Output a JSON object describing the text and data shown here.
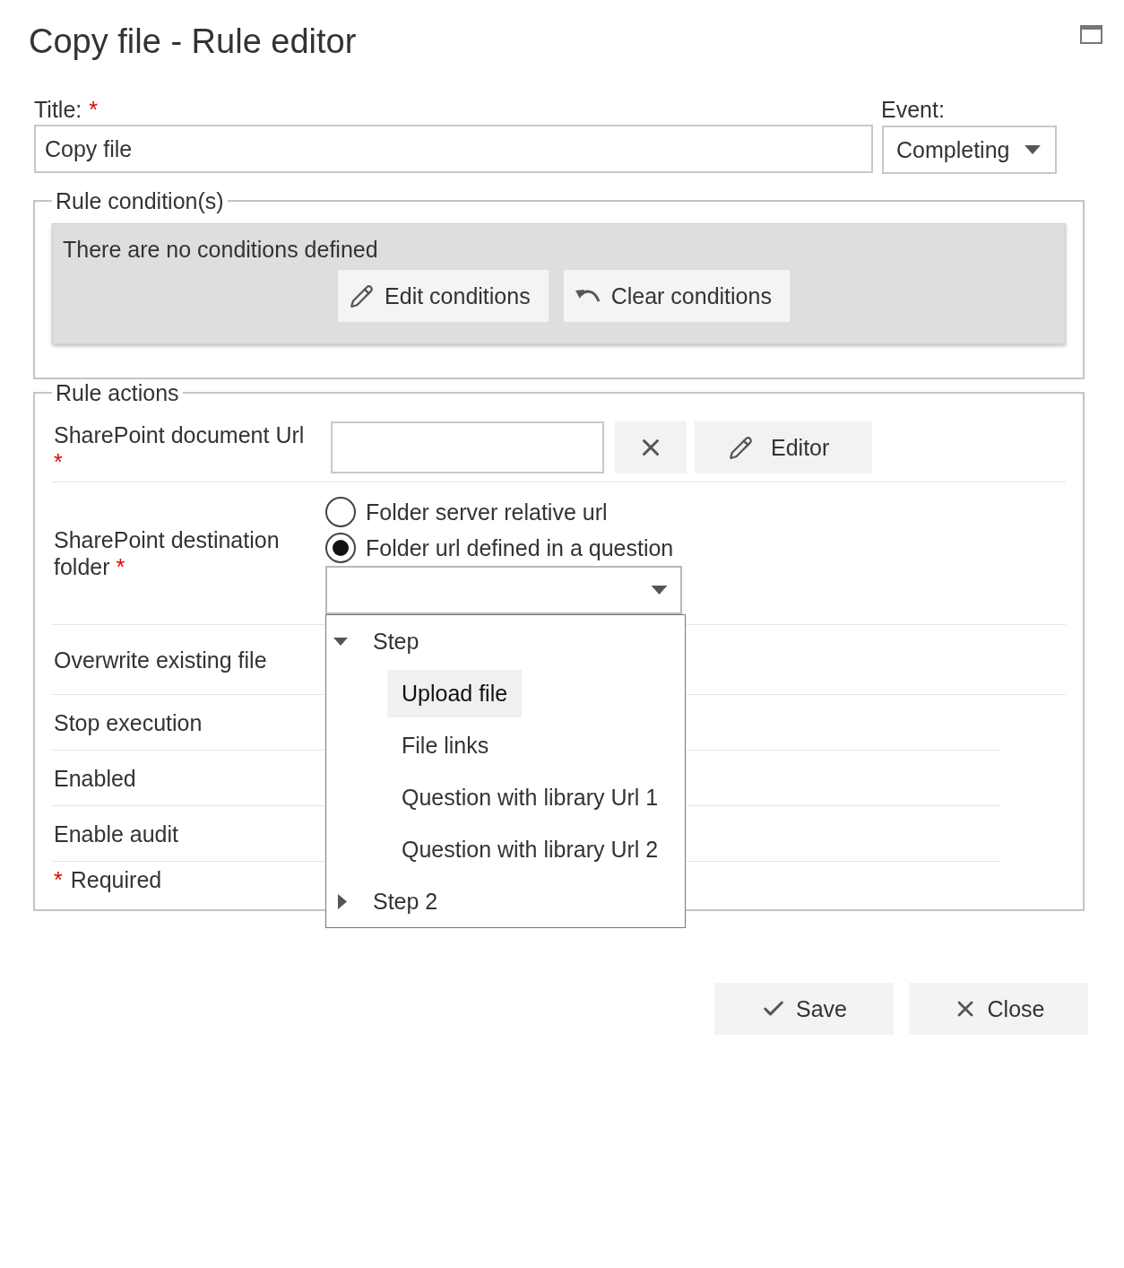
{
  "dialog": {
    "title": "Copy file - Rule editor"
  },
  "title_field": {
    "label": "Title:",
    "required_mark": "*",
    "value": "Copy file"
  },
  "event_field": {
    "label": "Event:",
    "value": "Completing"
  },
  "rule_conditions": {
    "legend": "Rule condition(s)",
    "message": "There are no conditions defined",
    "buttons": [
      {
        "kind": "edit",
        "label": "Edit conditions"
      },
      {
        "kind": "undo",
        "label": "Clear conditions"
      }
    ]
  },
  "rule_actions": {
    "legend": "Rule actions",
    "rows": [
      {
        "kind": "url",
        "label": "SharePoint document Url",
        "required_mark": "*",
        "editor_button": "Editor"
      },
      {
        "kind": "destination",
        "label": "SharePoint destination folder",
        "required_mark": "*",
        "options": [
          {
            "label": "Folder server relative url",
            "selected": false
          },
          {
            "label": "Folder url defined in a question",
            "selected": true
          }
        ],
        "question_select": {
          "open": true,
          "tree": [
            {
              "label": "Step",
              "expanded": true,
              "children": [
                {
                  "label": "Upload file",
                  "selected": true
                },
                {
                  "label": "File links",
                  "selected": false
                },
                {
                  "label": "Question with library Url 1",
                  "selected": false
                },
                {
                  "label": "Question with library Url 2",
                  "selected": false
                }
              ]
            },
            {
              "label": "Step 2",
              "expanded": false
            }
          ]
        }
      },
      {
        "kind": "setting",
        "label": "Overwrite existing file"
      },
      {
        "kind": "flag",
        "label": "Stop execution"
      },
      {
        "kind": "flag",
        "label": "Enabled"
      },
      {
        "kind": "flag",
        "label": "Enable audit"
      }
    ],
    "required_note": {
      "mark": "*",
      "text": "Required"
    }
  },
  "footer_buttons": [
    {
      "kind": "save",
      "label": "Save"
    },
    {
      "kind": "close",
      "label": "Close"
    }
  ]
}
